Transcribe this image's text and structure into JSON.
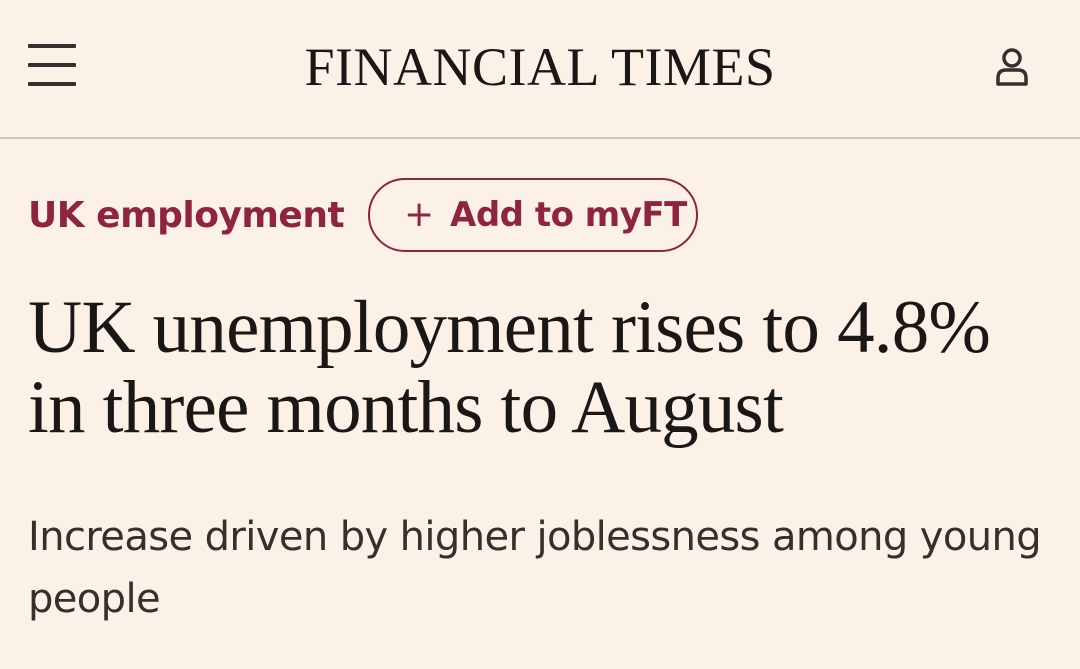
{
  "header": {
    "masthead": "FINANCIAL TIMES",
    "menu_icon": "hamburger-menu-icon",
    "user_icon": "user-account-icon"
  },
  "article": {
    "topic": "UK employment",
    "myft_button": {
      "plus": "+",
      "label": "Add to myFT"
    },
    "headline": "UK unemployment rises to 4.8% in three months to August",
    "standfirst": "Increase driven by higher joblessness among young people"
  },
  "colors": {
    "background": "#fcf1e6",
    "accent": "#8e2440",
    "text": "#1a1817",
    "subtext": "#33302e",
    "divider": "#cfc5bb"
  }
}
